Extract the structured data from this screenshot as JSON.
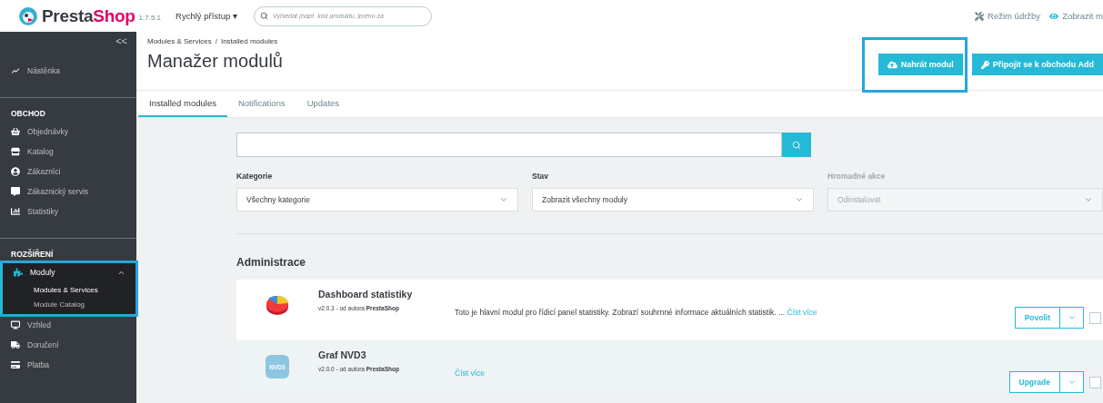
{
  "topbar": {
    "logo": {
      "name": "Presta",
      "accent": "Shop",
      "version": "1.7.5.1"
    },
    "quick_access": "Rychlý přístup",
    "quick_access_caret": "▾",
    "search": {
      "placeholder": "Vyhledat (např. kód produktu, jméno zá"
    },
    "links": [
      {
        "kind": "wrench",
        "label": "Režim údržby"
      },
      {
        "kind": "eye",
        "label": "Zobrazit m"
      }
    ]
  },
  "sidebar": {
    "collapse": "<<",
    "sections": [
      {
        "items": [
          {
            "kind": "chart",
            "label": "Nástěnka",
            "selected": false
          }
        ]
      },
      {
        "title": "OBCHOD",
        "items": [
          {
            "kind": "basket",
            "label": "Objednávky",
            "selected": false
          },
          {
            "kind": "store",
            "label": "Katalog",
            "selected": false
          },
          {
            "kind": "user",
            "label": "Zákazníci",
            "selected": false
          },
          {
            "kind": "chat",
            "label": "Zákaznický servis",
            "selected": false
          },
          {
            "kind": "stats",
            "label": "Statistiky",
            "selected": false
          }
        ]
      },
      {
        "title": "ROZŠÍŘENÍ",
        "items": [
          {
            "kind": "puzzle",
            "label": "Moduly",
            "selected": true,
            "highlighted": true,
            "expanded": true,
            "children": [
              {
                "label": "Modules & Services",
                "selected": true
              },
              {
                "label": "Module Catalog",
                "selected": false
              }
            ]
          },
          {
            "kind": "monitor",
            "label": "Vzhled",
            "selected": false
          },
          {
            "kind": "truck",
            "label": "Doručení",
            "selected": false
          },
          {
            "kind": "card",
            "label": "Platba",
            "selected": false
          }
        ]
      }
    ]
  },
  "header": {
    "breadcrumb": [
      "Modules & Services",
      "Installed modules"
    ],
    "breadcrumb_separator": "/",
    "title": "Manažer modulů",
    "buttons": [
      {
        "kind": "upload",
        "label": "Nahrát modul",
        "highlighted": true
      },
      {
        "kind": "key",
        "label": "Připojit se k obchodu Add"
      }
    ]
  },
  "tabs": [
    {
      "label": "Installed modules",
      "selected": true
    },
    {
      "label": "Notifications",
      "selected": false
    },
    {
      "label": "Updates",
      "selected": false
    }
  ],
  "filters": [
    {
      "label": "Kategorie",
      "value": "Všechny kategorie",
      "disabled": false
    },
    {
      "label": "Stav",
      "value": "Zobrazit všechny moduly",
      "disabled": false
    },
    {
      "label": "Hromadné akce",
      "value": "Odinstalovat",
      "disabled": true
    }
  ],
  "section_title": "Administrace",
  "modules": [
    {
      "kind": "pie",
      "name": "Dashboard statistiky",
      "version": "v2.0.3 - od autora",
      "author": "PrestaShop",
      "description": "Toto je hlavní modul pro řídicí panel statistiky. Zobrazí souhrnné informace aktuálních statistik. ...",
      "read_more": "Číst více",
      "action": "Povolit",
      "hovered": false,
      "checked": false
    },
    {
      "kind": "badge",
      "icon_text": "NVD3",
      "name": "Graf NVD3",
      "version": "v2.0.0 - od autora",
      "author": "PrestaShop",
      "read_more": "Číst více",
      "action": "Upgrade",
      "hovered": true,
      "checked": false
    }
  ]
}
